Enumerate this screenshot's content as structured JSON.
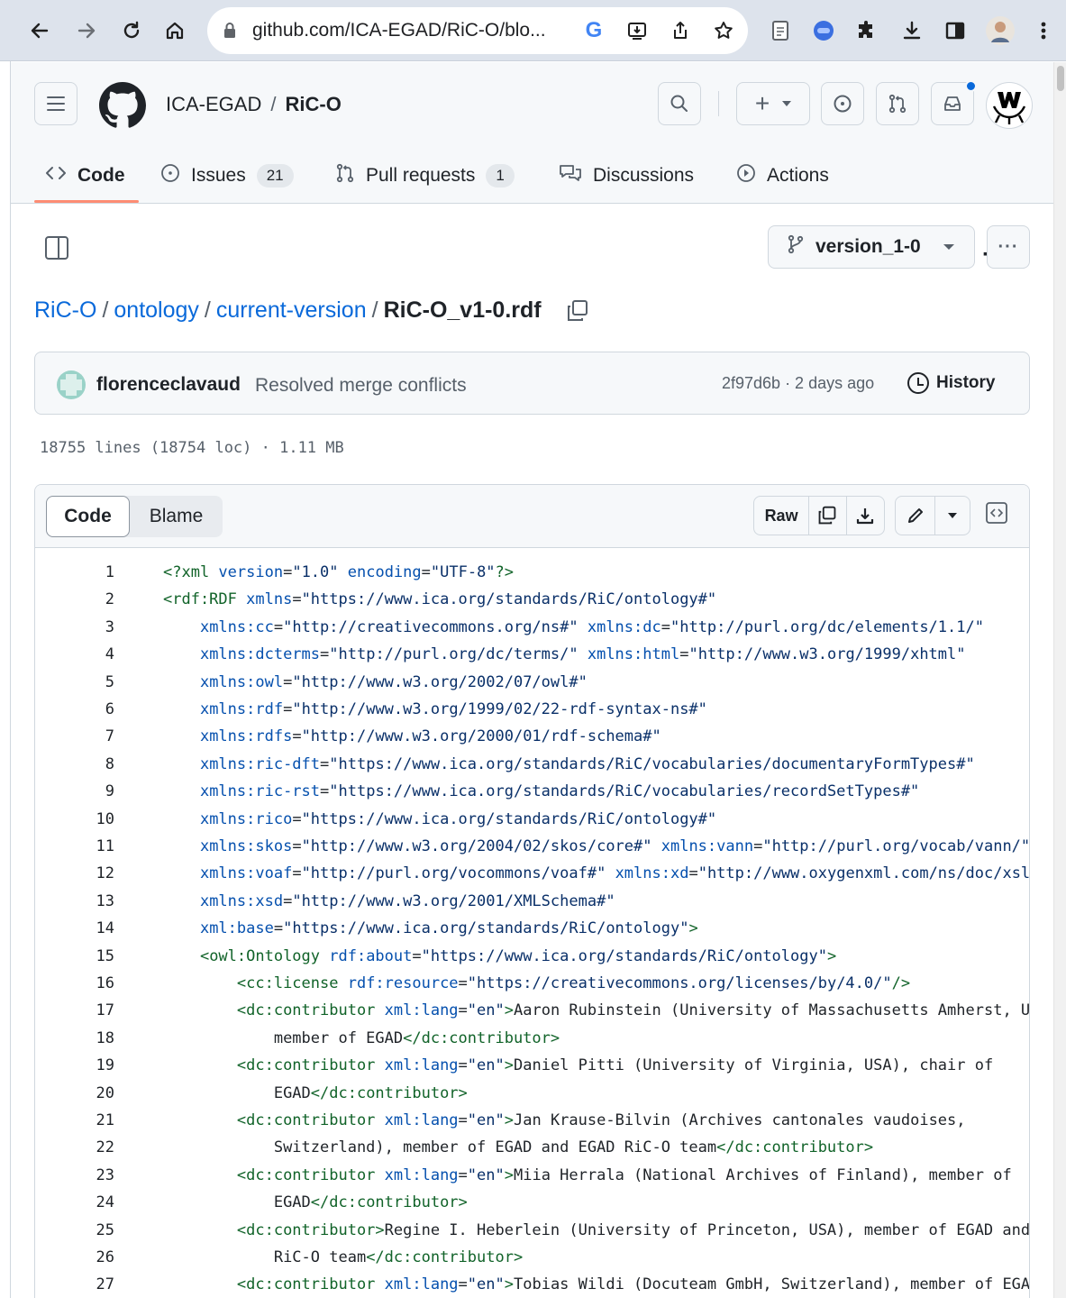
{
  "browser": {
    "url": "github.com/ICA-EGAD/RiC-O/blo..."
  },
  "header": {
    "owner": "ICA-EGAD",
    "separator": "/",
    "repo": "RiC-O",
    "add_label": "+"
  },
  "tabs": [
    {
      "label": "Code"
    },
    {
      "label": "Issues",
      "count": "21"
    },
    {
      "label": "Pull requests",
      "count": "1"
    },
    {
      "label": "Discussions"
    },
    {
      "label": "Actions"
    }
  ],
  "branch": "version_1-0",
  "breadcrumb": {
    "parts": [
      "RiC-O",
      "ontology",
      "current-version"
    ],
    "file": "RiC-O_v1-0.rdf",
    "sep": "/"
  },
  "commit": {
    "author": "florenceclavaud",
    "message": "Resolved merge conflicts",
    "meta": "2f97d6b · 2 days ago",
    "history_label": "History"
  },
  "file_stats": "18755 lines (18754 loc) · 1.11 MB",
  "view": {
    "code_label": "Code",
    "blame_label": "Blame",
    "raw_label": "Raw"
  },
  "code_lines": [
    {
      "n": "1",
      "indent": 0,
      "parts": [
        [
          "tg",
          "<?xml "
        ],
        [
          "at",
          "version"
        ],
        [
          "",
          "="
        ],
        [
          "st",
          "\"1.0\""
        ],
        [
          "",
          ""
        ],
        [
          "at",
          " encoding"
        ],
        [
          "",
          "="
        ],
        [
          "st",
          "\"UTF-8\""
        ],
        [
          "tg",
          "?>"
        ]
      ]
    },
    {
      "n": "2",
      "indent": 0,
      "parts": [
        [
          "tg",
          "<rdf:RDF "
        ],
        [
          "at",
          "xmlns"
        ],
        [
          "",
          "="
        ],
        [
          "st",
          "\"https://www.ica.org/standards/RiC/ontology#\""
        ]
      ]
    },
    {
      "n": "3",
      "indent": 4,
      "parts": [
        [
          "at",
          "xmlns:cc"
        ],
        [
          "",
          "="
        ],
        [
          "st",
          "\"http://creativecommons.org/ns#\""
        ],
        [
          "at",
          " xmlns:dc"
        ],
        [
          "",
          "="
        ],
        [
          "st",
          "\"http://purl.org/dc/elements/1.1/\""
        ]
      ]
    },
    {
      "n": "4",
      "indent": 4,
      "parts": [
        [
          "at",
          "xmlns:dcterms"
        ],
        [
          "",
          "="
        ],
        [
          "st",
          "\"http://purl.org/dc/terms/\""
        ],
        [
          "at",
          " xmlns:html"
        ],
        [
          "",
          "="
        ],
        [
          "st",
          "\"http://www.w3.org/1999/xhtml\""
        ]
      ]
    },
    {
      "n": "5",
      "indent": 4,
      "parts": [
        [
          "at",
          "xmlns:owl"
        ],
        [
          "",
          "="
        ],
        [
          "st",
          "\"http://www.w3.org/2002/07/owl#\""
        ]
      ]
    },
    {
      "n": "6",
      "indent": 4,
      "parts": [
        [
          "at",
          "xmlns:rdf"
        ],
        [
          "",
          "="
        ],
        [
          "st",
          "\"http://www.w3.org/1999/02/22-rdf-syntax-ns#\""
        ]
      ]
    },
    {
      "n": "7",
      "indent": 4,
      "parts": [
        [
          "at",
          "xmlns:rdfs"
        ],
        [
          "",
          "="
        ],
        [
          "st",
          "\"http://www.w3.org/2000/01/rdf-schema#\""
        ]
      ]
    },
    {
      "n": "8",
      "indent": 4,
      "parts": [
        [
          "at",
          "xmlns:ric-dft"
        ],
        [
          "",
          "="
        ],
        [
          "st",
          "\"https://www.ica.org/standards/RiC/vocabularies/documentaryFormTypes#\""
        ]
      ]
    },
    {
      "n": "9",
      "indent": 4,
      "parts": [
        [
          "at",
          "xmlns:ric-rst"
        ],
        [
          "",
          "="
        ],
        [
          "st",
          "\"https://www.ica.org/standards/RiC/vocabularies/recordSetTypes#\""
        ]
      ]
    },
    {
      "n": "10",
      "indent": 4,
      "parts": [
        [
          "at",
          "xmlns:rico"
        ],
        [
          "",
          "="
        ],
        [
          "st",
          "\"https://www.ica.org/standards/RiC/ontology#\""
        ]
      ]
    },
    {
      "n": "11",
      "indent": 4,
      "parts": [
        [
          "at",
          "xmlns:skos"
        ],
        [
          "",
          "="
        ],
        [
          "st",
          "\"http://www.w3.org/2004/02/skos/core#\""
        ],
        [
          "at",
          " xmlns:vann"
        ],
        [
          "",
          "="
        ],
        [
          "st",
          "\"http://purl.org/vocab/vann/\""
        ]
      ]
    },
    {
      "n": "12",
      "indent": 4,
      "parts": [
        [
          "at",
          "xmlns:voaf"
        ],
        [
          "",
          "="
        ],
        [
          "st",
          "\"http://purl.org/vocommons/voaf#\""
        ],
        [
          "at",
          " xmlns:xd"
        ],
        [
          "",
          "="
        ],
        [
          "st",
          "\"http://www.oxygenxml.com/ns/doc/xsl\""
        ]
      ]
    },
    {
      "n": "13",
      "indent": 4,
      "parts": [
        [
          "at",
          "xmlns:xsd"
        ],
        [
          "",
          "="
        ],
        [
          "st",
          "\"http://www.w3.org/2001/XMLSchema#\""
        ]
      ]
    },
    {
      "n": "14",
      "indent": 4,
      "parts": [
        [
          "at",
          "xml:base"
        ],
        [
          "",
          "="
        ],
        [
          "st",
          "\"https://www.ica.org/standards/RiC/ontology\""
        ],
        [
          "tg",
          ">"
        ]
      ]
    },
    {
      "n": "15",
      "indent": 4,
      "parts": [
        [
          "tg",
          "<owl:Ontology "
        ],
        [
          "at",
          "rdf:about"
        ],
        [
          "",
          "="
        ],
        [
          "st",
          "\"https://www.ica.org/standards/RiC/ontology\""
        ],
        [
          "tg",
          ">"
        ]
      ]
    },
    {
      "n": "16",
      "indent": 8,
      "parts": [
        [
          "tg",
          "<cc:license "
        ],
        [
          "at",
          "rdf:resource"
        ],
        [
          "",
          "="
        ],
        [
          "st",
          "\"https://creativecommons.org/licenses/by/4.0/\""
        ],
        [
          "tg",
          "/>"
        ]
      ]
    },
    {
      "n": "17",
      "indent": 8,
      "parts": [
        [
          "tg",
          "<dc:contributor "
        ],
        [
          "at",
          "xml:lang"
        ],
        [
          "",
          "="
        ],
        [
          "st",
          "\"en\""
        ],
        [
          "tg",
          ">"
        ],
        [
          "",
          "Aaron Rubinstein (University of Massachusetts Amherst, USA),"
        ]
      ]
    },
    {
      "n": "18",
      "indent": 12,
      "parts": [
        [
          "",
          "member of EGAD"
        ],
        [
          "tg",
          "</dc:contributor>"
        ]
      ]
    },
    {
      "n": "19",
      "indent": 8,
      "parts": [
        [
          "tg",
          "<dc:contributor "
        ],
        [
          "at",
          "xml:lang"
        ],
        [
          "",
          "="
        ],
        [
          "st",
          "\"en\""
        ],
        [
          "tg",
          ">"
        ],
        [
          "",
          "Daniel Pitti (University of Virginia, USA), chair of"
        ]
      ]
    },
    {
      "n": "20",
      "indent": 12,
      "parts": [
        [
          "",
          "EGAD"
        ],
        [
          "tg",
          "</dc:contributor>"
        ]
      ]
    },
    {
      "n": "21",
      "indent": 8,
      "parts": [
        [
          "tg",
          "<dc:contributor "
        ],
        [
          "at",
          "xml:lang"
        ],
        [
          "",
          "="
        ],
        [
          "st",
          "\"en\""
        ],
        [
          "tg",
          ">"
        ],
        [
          "",
          "Jan Krause-Bilvin (Archives cantonales vaudoises,"
        ]
      ]
    },
    {
      "n": "22",
      "indent": 12,
      "parts": [
        [
          "",
          "Switzerland), member of EGAD and EGAD RiC-O team"
        ],
        [
          "tg",
          "</dc:contributor>"
        ]
      ]
    },
    {
      "n": "23",
      "indent": 8,
      "parts": [
        [
          "tg",
          "<dc:contributor "
        ],
        [
          "at",
          "xml:lang"
        ],
        [
          "",
          "="
        ],
        [
          "st",
          "\"en\""
        ],
        [
          "tg",
          ">"
        ],
        [
          "",
          "Miia Herrala (National Archives of Finland), member of"
        ]
      ]
    },
    {
      "n": "24",
      "indent": 12,
      "parts": [
        [
          "",
          "EGAD"
        ],
        [
          "tg",
          "</dc:contributor>"
        ]
      ]
    },
    {
      "n": "25",
      "indent": 8,
      "parts": [
        [
          "tg",
          "<dc:contributor>"
        ],
        [
          "",
          "Regine I. Heberlein (University of Princeton, USA), member of EGAD and EGAD"
        ]
      ]
    },
    {
      "n": "26",
      "indent": 12,
      "parts": [
        [
          "",
          "RiC-O team"
        ],
        [
          "tg",
          "</dc:contributor>"
        ]
      ]
    },
    {
      "n": "27",
      "indent": 8,
      "parts": [
        [
          "tg",
          "<dc:contributor "
        ],
        [
          "at",
          "xml:lang"
        ],
        [
          "",
          "="
        ],
        [
          "st",
          "\"en\""
        ],
        [
          "tg",
          ">"
        ],
        [
          "",
          "Tobias Wildi (Docuteam GmbH, Switzerland), member of EGAD"
        ]
      ]
    }
  ]
}
